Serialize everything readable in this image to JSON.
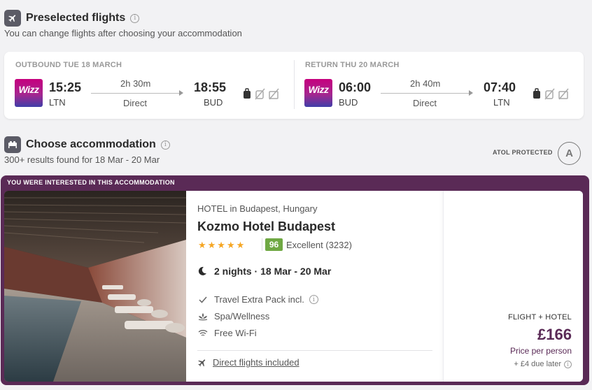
{
  "preselected": {
    "title": "Preselected flights",
    "subtitle": "You can change flights after choosing your accommodation"
  },
  "flights": {
    "outbound": {
      "label": "OUTBOUND TUE 18 MARCH",
      "airline_logo_text": "Wizz",
      "dep_time": "15:25",
      "dep_code": "LTN",
      "duration": "2h 30m",
      "stops": "Direct",
      "arr_time": "18:55",
      "arr_code": "BUD"
    },
    "return": {
      "label": "RETURN THU 20 MARCH",
      "airline_logo_text": "Wizz",
      "dep_time": "06:00",
      "dep_code": "BUD",
      "duration": "2h 40m",
      "stops": "Direct",
      "arr_time": "07:40",
      "arr_code": "LTN"
    }
  },
  "accommodation": {
    "title": "Choose accommodation",
    "results": "300+ results found for 18 Mar - 20 Mar",
    "atol": "ATOL PROTECTED",
    "atol_seal": "A"
  },
  "promo": {
    "label": "YOU WERE INTERESTED IN THIS ACCOMMODATION",
    "color": "#5a2a56"
  },
  "hotel": {
    "type": "HOTEL in Budapest, Hungary",
    "name": "Kozmo Hotel Budapest",
    "stars": "★★★★★",
    "star_rating": 5,
    "score": "96",
    "score_text": "Excellent (3232)",
    "stay": "2 nights · 18 Mar - 20 Mar",
    "amenities": [
      "Travel Extra Pack incl.",
      "Spa/Wellness",
      "Free Wi-Fi"
    ],
    "direct_flights": "Direct flights included"
  },
  "price": {
    "package": "FLIGHT + HOTEL",
    "amount": "£166",
    "per_person": "Price per person",
    "due_later": "+ £4 due later"
  },
  "icons": {
    "plane": "plane-icon",
    "bed": "bed-icon",
    "cabin_bag": "cabin-bag-icon",
    "no_checked_bag": "no-checked-bag-icon",
    "no_hold_bag": "no-hold-bag-icon",
    "moon": "moon-icon",
    "check": "check-icon",
    "spa": "spa-icon",
    "wifi": "wifi-icon"
  }
}
